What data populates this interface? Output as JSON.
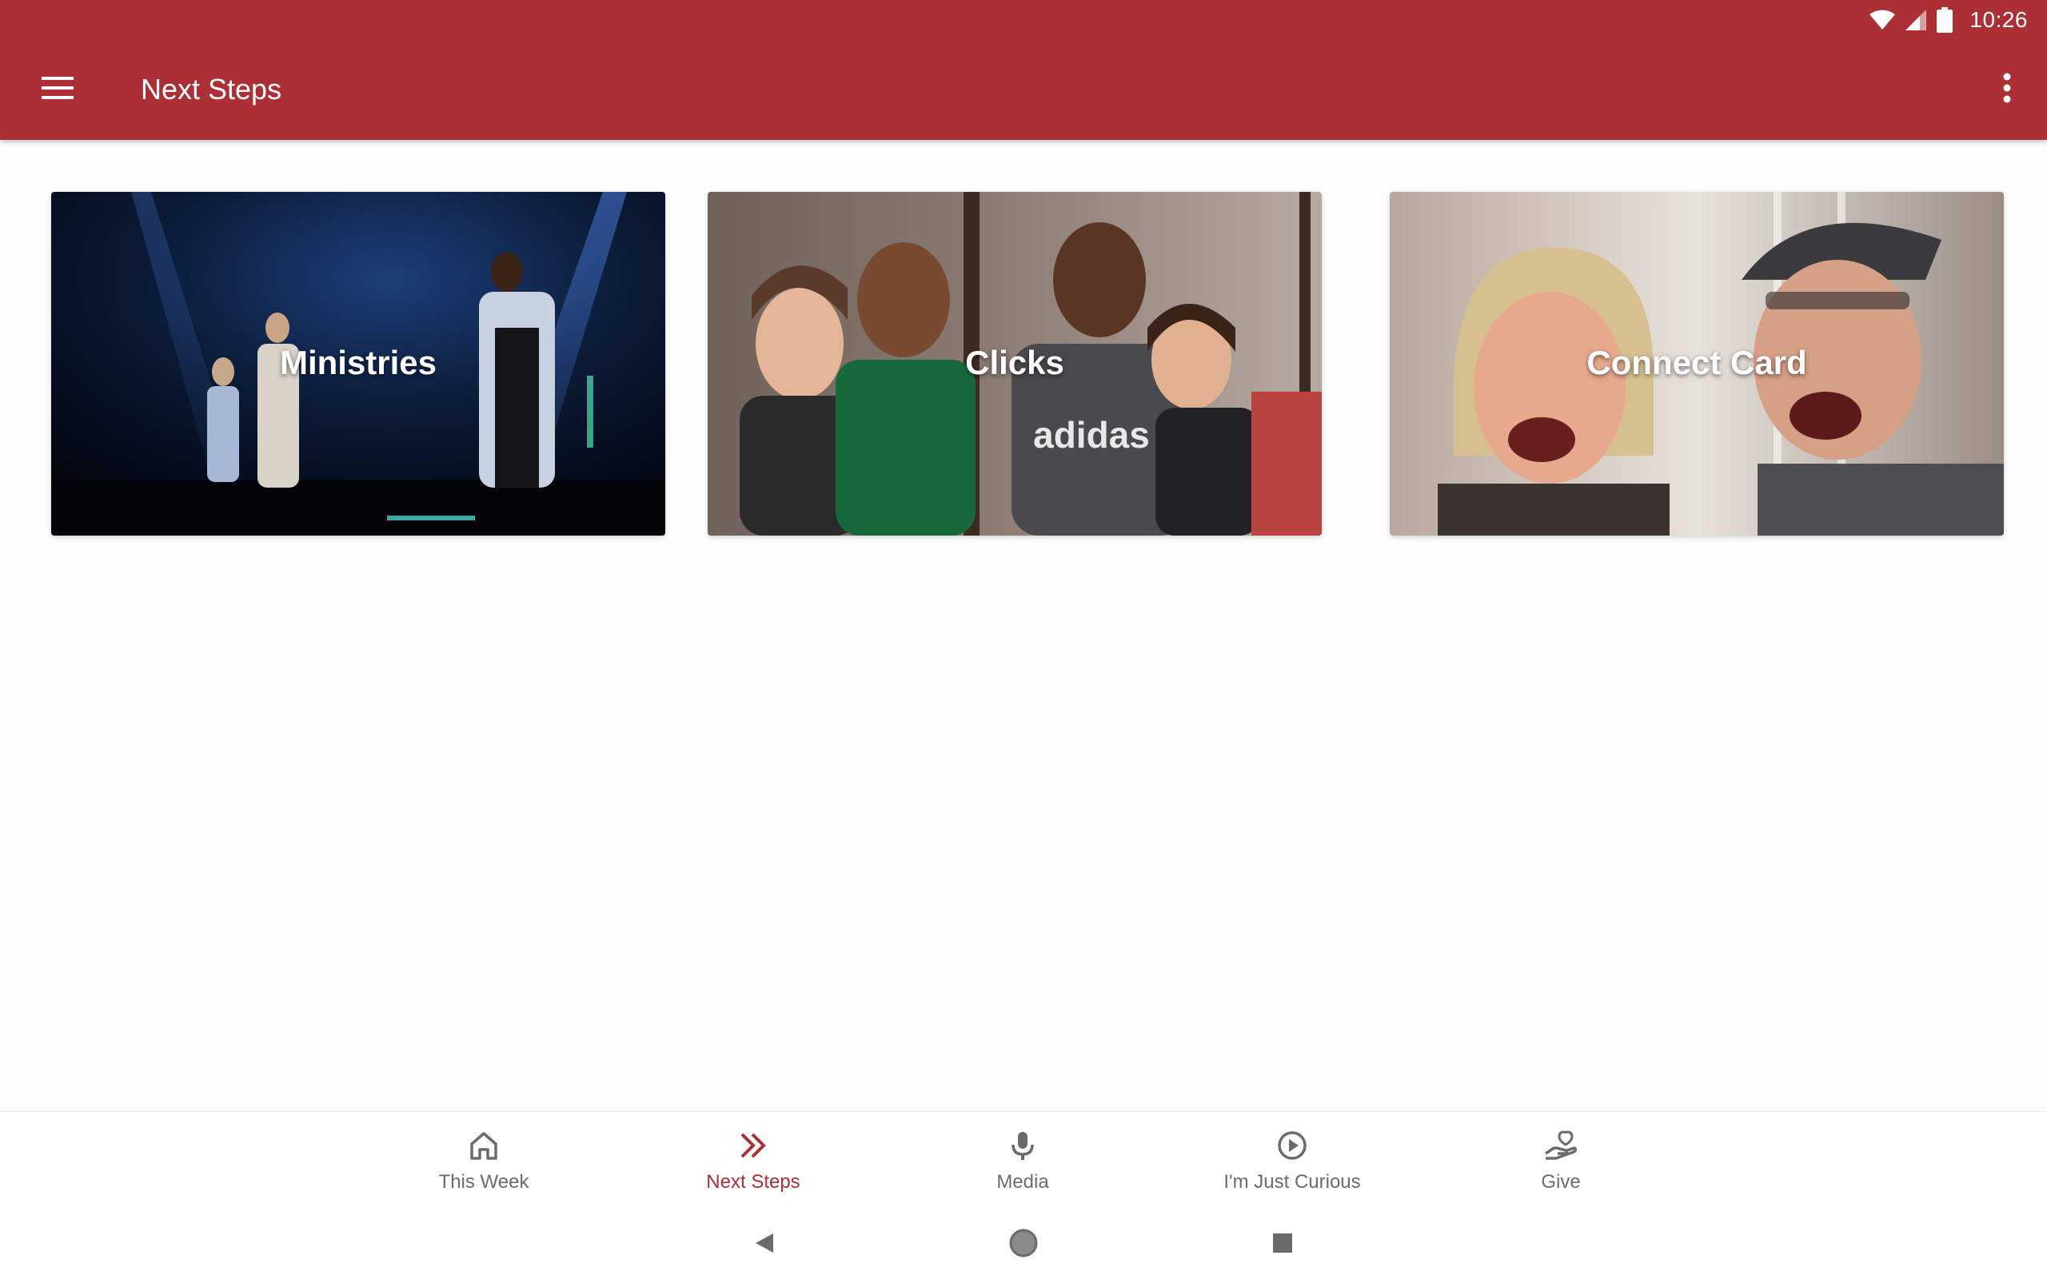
{
  "status_bar": {
    "time": "10:26",
    "icons": [
      "wifi-icon",
      "cell-signal-icon",
      "battery-icon"
    ]
  },
  "toolbar": {
    "title": "Next Steps",
    "menu_icon": "hamburger-menu-icon",
    "overflow_icon": "more-vert-icon",
    "background_color": "#ab2f35"
  },
  "cards": [
    {
      "label": "Ministries"
    },
    {
      "label": "Clicks"
    },
    {
      "label": "Connect Card"
    }
  ],
  "bottom_nav": {
    "active_color": "#ab2f35",
    "inactive_color": "#6b6b6b",
    "items": [
      {
        "label": "This Week",
        "icon": "home-icon",
        "active": false
      },
      {
        "label": "Next Steps",
        "icon": "double-chevron-right-icon",
        "active": true
      },
      {
        "label": "Media",
        "icon": "microphone-icon",
        "active": false
      },
      {
        "label": "I'm Just Curious",
        "icon": "play-circle-icon",
        "active": false
      },
      {
        "label": "Give",
        "icon": "give-hand-icon",
        "active": false
      }
    ]
  },
  "system_nav": {
    "buttons": [
      "back-icon",
      "home-circle-icon",
      "recents-icon"
    ]
  }
}
